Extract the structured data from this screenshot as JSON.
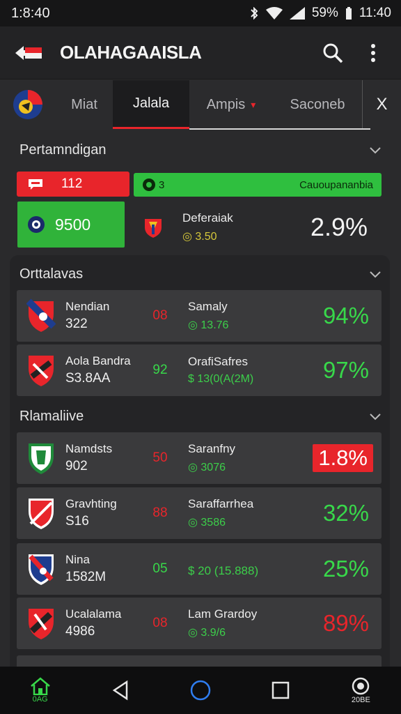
{
  "status_bar": {
    "time_left": "1:8:40",
    "battery": "59%",
    "time_right": "11:40"
  },
  "app_bar": {
    "title": "OLAHAGAAISLA"
  },
  "tabs": [
    {
      "label": ""
    },
    {
      "label": "Miat"
    },
    {
      "label": "Jalala"
    },
    {
      "label": "Ampis"
    },
    {
      "label": "Saconeb"
    },
    {
      "label": "X"
    }
  ],
  "section1": {
    "title": "Pertamndigan",
    "red_bar_value": "112",
    "green_bar_left": "3",
    "green_bar_right": "Cauoupananbia",
    "green_box_value": "9500",
    "feature": {
      "name": "Deferaiak",
      "odds": "3.50",
      "percent": "2.9%"
    }
  },
  "section2": {
    "title": "Orttalavas",
    "rows": [
      {
        "team": "Nendian",
        "team_sub": "322",
        "score": "08",
        "opponent": "Samaly",
        "odds": "13.76",
        "percent": "94%"
      },
      {
        "team": "Aola Bandra",
        "team_sub": "S3.8AA",
        "score": "92",
        "opponent": "OrafiSafres",
        "odds": "13(0(A(2M)",
        "percent": "97%"
      }
    ]
  },
  "section3": {
    "title": "Rlamaliive",
    "rows": [
      {
        "team": "Namdsts",
        "team_sub": "902",
        "score": "50",
        "opponent": "Saranfny",
        "odds": "3076",
        "percent": "1.8%"
      },
      {
        "team": "Gravhting",
        "team_sub": "S16",
        "score": "88",
        "opponent": "Saraffarrhea",
        "odds": "3586",
        "percent": "32%"
      },
      {
        "team": "Nina",
        "team_sub": "1582M",
        "score": "05",
        "opponent": "",
        "odds": "$ 20 (15.888)",
        "percent": "25%"
      },
      {
        "team": "Ucalalama",
        "team_sub": "4986",
        "score": "08",
        "opponent": "Lam Grardoy",
        "odds": "3.9/6",
        "percent": "89%"
      }
    ]
  },
  "nav": {
    "home_label": "0AG",
    "extra_label": "20BE"
  },
  "colors": {
    "accent_red": "#e8252b",
    "accent_green": "#38d84a",
    "background": "#2a2a2c"
  }
}
